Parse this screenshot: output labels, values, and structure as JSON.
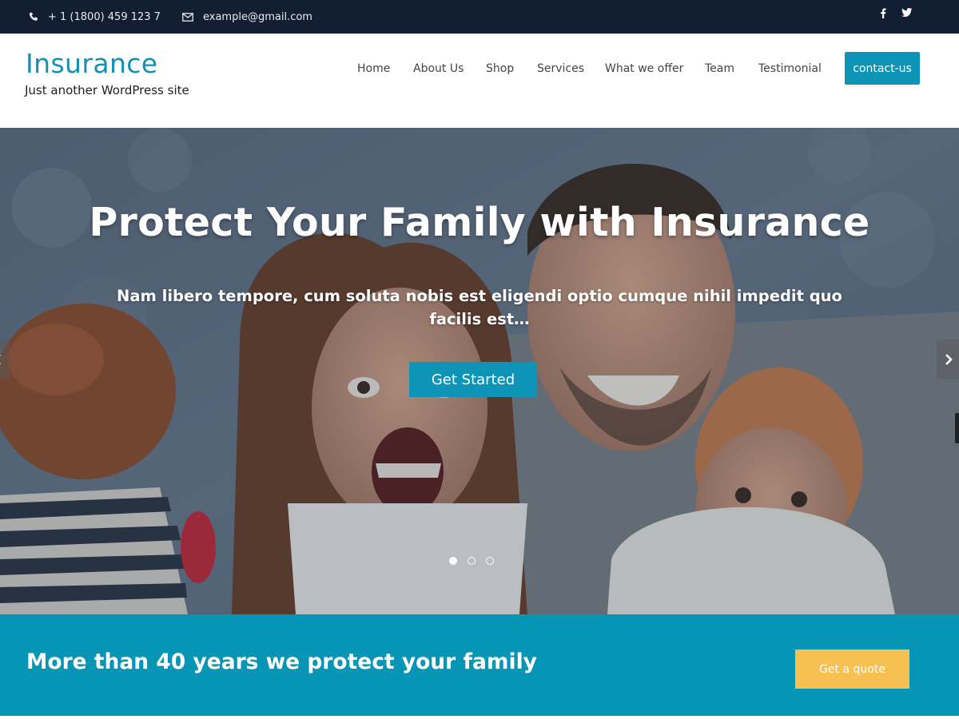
{
  "topbar": {
    "phone": "+ 1 (1800) 459 123 7",
    "email": "example@gmail.com",
    "social": [
      "facebook-icon",
      "twitter-icon"
    ]
  },
  "header": {
    "site_title": "Insurance",
    "tagline": "Just another WordPress site",
    "nav": {
      "home": "Home",
      "about": "About Us",
      "shop": "Shop",
      "services": "Services",
      "offer": "What we offer",
      "team": "Team",
      "testimonial": "Testimonial"
    },
    "contact_button": "contact-us"
  },
  "hero": {
    "title": "Protect Your Family with Insurance",
    "subtitle": "Nam libero tempore, cum soluta nobis est eligendi optio cumque nihil impedit quo facilis est…",
    "button": "Get Started",
    "slides": 3,
    "active_slide": 1
  },
  "cta": {
    "text": "More than 40 years we protect your family",
    "button": "Get a quote"
  },
  "colors": {
    "topbar": "#121f33",
    "brand": "#1291b4",
    "accent": "#0d94b7",
    "cta_band": "#0795b6",
    "quote_button": "#f7c152"
  }
}
